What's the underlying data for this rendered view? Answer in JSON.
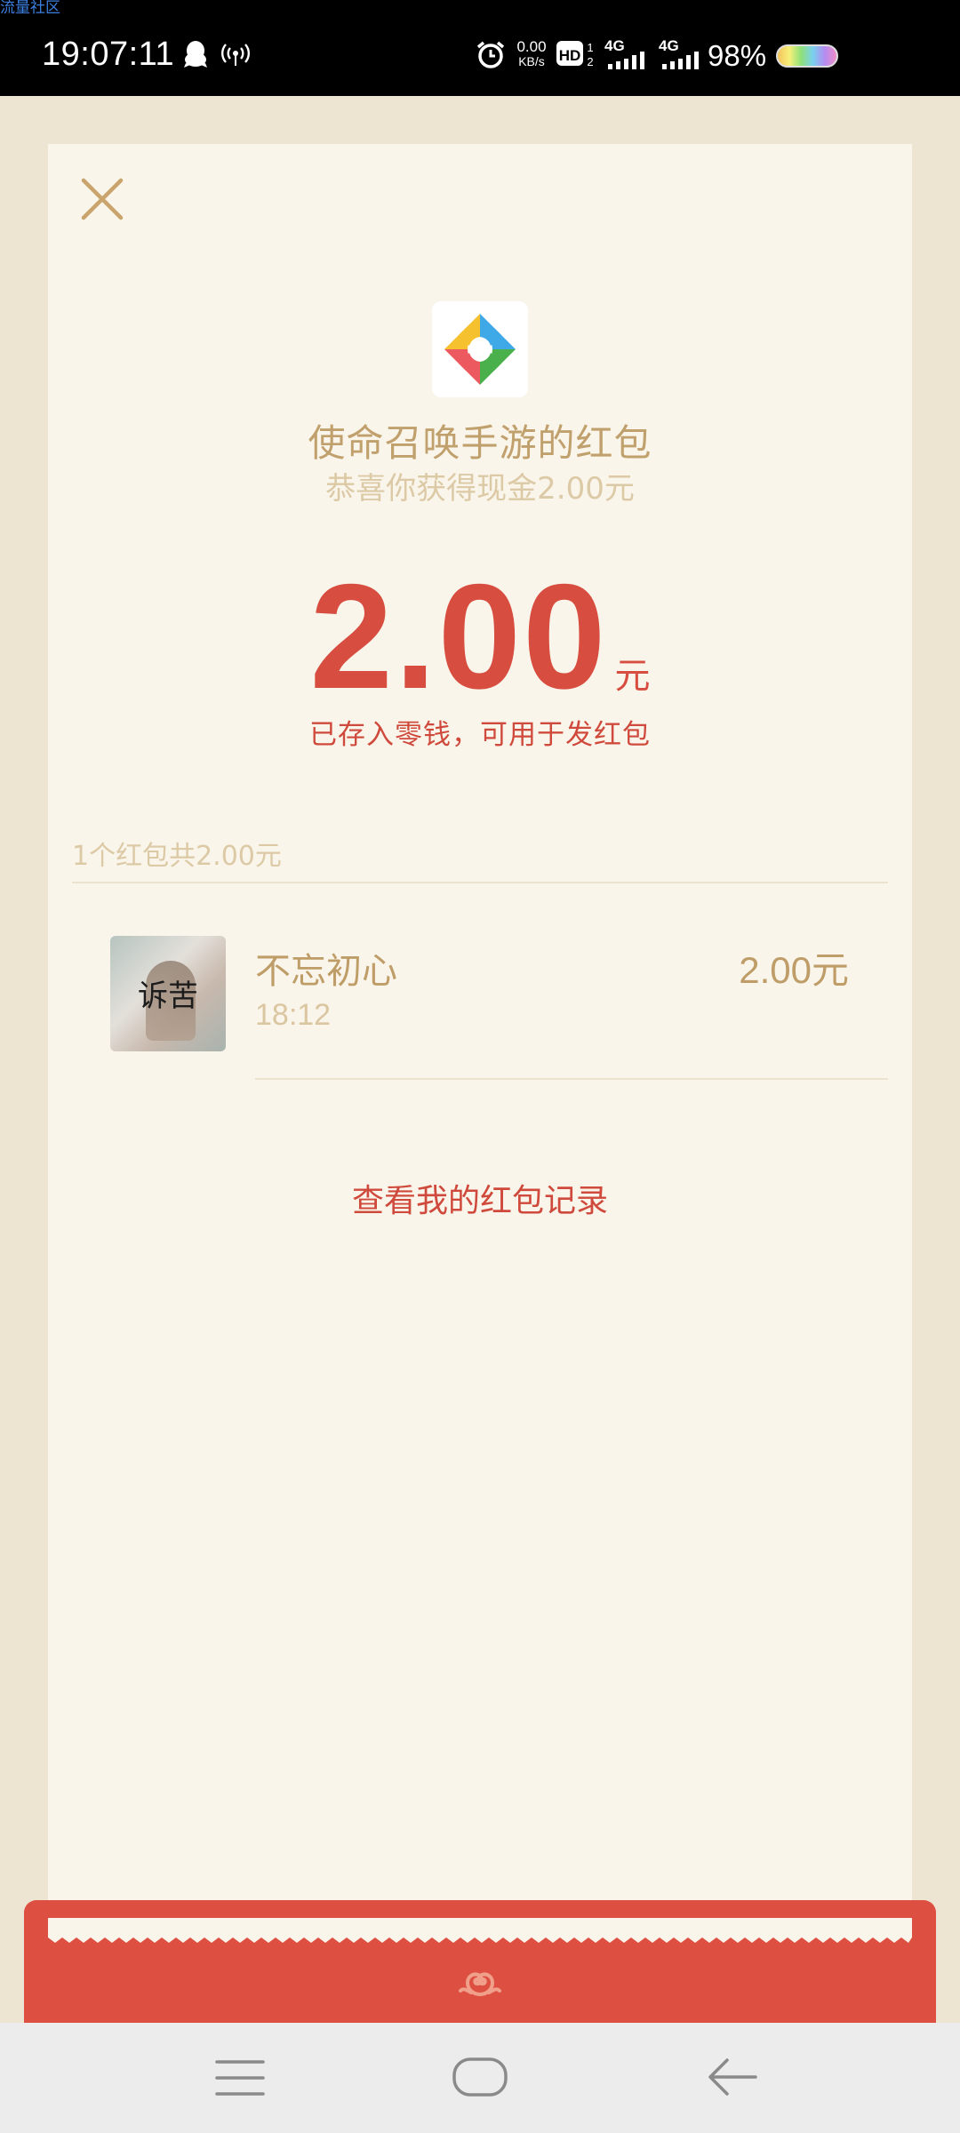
{
  "watermark": "流量社区",
  "status_bar": {
    "time": "19:07:11",
    "net_speed_value": "0.00",
    "net_speed_unit": "KB/s",
    "network_1": "4G",
    "network_2": "4G",
    "battery_percent": "98%",
    "icons": [
      "qq-icon",
      "hotspot-icon",
      "alarm-icon",
      "hd-icon",
      "signal-icon",
      "battery-icon"
    ]
  },
  "packet": {
    "title": "使命召唤手游的红包",
    "subtitle": "恭喜你获得现金2.00元",
    "amount": "2.00",
    "amount_unit": "元",
    "saved_note": "已存入零钱，可用于发红包",
    "summary": "1个红包共2.00元",
    "history_link": "查看我的红包记录"
  },
  "receivers": [
    {
      "name": "不忘初心",
      "time": "18:12",
      "amount": "2.00元",
      "avatar_text": "诉苦"
    }
  ],
  "colors": {
    "background": "#ede4d2",
    "card": "#faf5ea",
    "accent_red": "#d74d40",
    "gold_text": "#c0a06c",
    "envelope_red": "#dc4f41"
  },
  "nav_bar": {
    "buttons": [
      "menu-icon",
      "home-icon",
      "back-icon"
    ]
  }
}
